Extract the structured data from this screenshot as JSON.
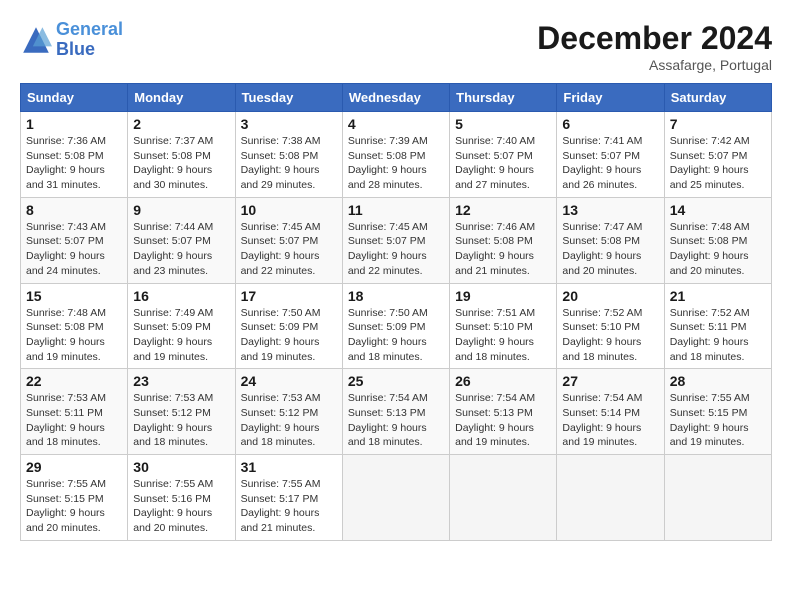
{
  "header": {
    "logo_line1": "General",
    "logo_line2": "Blue",
    "month_title": "December 2024",
    "location": "Assafarge, Portugal"
  },
  "weekdays": [
    "Sunday",
    "Monday",
    "Tuesday",
    "Wednesday",
    "Thursday",
    "Friday",
    "Saturday"
  ],
  "weeks": [
    [
      {
        "day": "1",
        "sunrise": "Sunrise: 7:36 AM",
        "sunset": "Sunset: 5:08 PM",
        "daylight": "Daylight: 9 hours and 31 minutes."
      },
      {
        "day": "2",
        "sunrise": "Sunrise: 7:37 AM",
        "sunset": "Sunset: 5:08 PM",
        "daylight": "Daylight: 9 hours and 30 minutes."
      },
      {
        "day": "3",
        "sunrise": "Sunrise: 7:38 AM",
        "sunset": "Sunset: 5:08 PM",
        "daylight": "Daylight: 9 hours and 29 minutes."
      },
      {
        "day": "4",
        "sunrise": "Sunrise: 7:39 AM",
        "sunset": "Sunset: 5:08 PM",
        "daylight": "Daylight: 9 hours and 28 minutes."
      },
      {
        "day": "5",
        "sunrise": "Sunrise: 7:40 AM",
        "sunset": "Sunset: 5:07 PM",
        "daylight": "Daylight: 9 hours and 27 minutes."
      },
      {
        "day": "6",
        "sunrise": "Sunrise: 7:41 AM",
        "sunset": "Sunset: 5:07 PM",
        "daylight": "Daylight: 9 hours and 26 minutes."
      },
      {
        "day": "7",
        "sunrise": "Sunrise: 7:42 AM",
        "sunset": "Sunset: 5:07 PM",
        "daylight": "Daylight: 9 hours and 25 minutes."
      }
    ],
    [
      {
        "day": "8",
        "sunrise": "Sunrise: 7:43 AM",
        "sunset": "Sunset: 5:07 PM",
        "daylight": "Daylight: 9 hours and 24 minutes."
      },
      {
        "day": "9",
        "sunrise": "Sunrise: 7:44 AM",
        "sunset": "Sunset: 5:07 PM",
        "daylight": "Daylight: 9 hours and 23 minutes."
      },
      {
        "day": "10",
        "sunrise": "Sunrise: 7:45 AM",
        "sunset": "Sunset: 5:07 PM",
        "daylight": "Daylight: 9 hours and 22 minutes."
      },
      {
        "day": "11",
        "sunrise": "Sunrise: 7:45 AM",
        "sunset": "Sunset: 5:07 PM",
        "daylight": "Daylight: 9 hours and 22 minutes."
      },
      {
        "day": "12",
        "sunrise": "Sunrise: 7:46 AM",
        "sunset": "Sunset: 5:08 PM",
        "daylight": "Daylight: 9 hours and 21 minutes."
      },
      {
        "day": "13",
        "sunrise": "Sunrise: 7:47 AM",
        "sunset": "Sunset: 5:08 PM",
        "daylight": "Daylight: 9 hours and 20 minutes."
      },
      {
        "day": "14",
        "sunrise": "Sunrise: 7:48 AM",
        "sunset": "Sunset: 5:08 PM",
        "daylight": "Daylight: 9 hours and 20 minutes."
      }
    ],
    [
      {
        "day": "15",
        "sunrise": "Sunrise: 7:48 AM",
        "sunset": "Sunset: 5:08 PM",
        "daylight": "Daylight: 9 hours and 19 minutes."
      },
      {
        "day": "16",
        "sunrise": "Sunrise: 7:49 AM",
        "sunset": "Sunset: 5:09 PM",
        "daylight": "Daylight: 9 hours and 19 minutes."
      },
      {
        "day": "17",
        "sunrise": "Sunrise: 7:50 AM",
        "sunset": "Sunset: 5:09 PM",
        "daylight": "Daylight: 9 hours and 19 minutes."
      },
      {
        "day": "18",
        "sunrise": "Sunrise: 7:50 AM",
        "sunset": "Sunset: 5:09 PM",
        "daylight": "Daylight: 9 hours and 18 minutes."
      },
      {
        "day": "19",
        "sunrise": "Sunrise: 7:51 AM",
        "sunset": "Sunset: 5:10 PM",
        "daylight": "Daylight: 9 hours and 18 minutes."
      },
      {
        "day": "20",
        "sunrise": "Sunrise: 7:52 AM",
        "sunset": "Sunset: 5:10 PM",
        "daylight": "Daylight: 9 hours and 18 minutes."
      },
      {
        "day": "21",
        "sunrise": "Sunrise: 7:52 AM",
        "sunset": "Sunset: 5:11 PM",
        "daylight": "Daylight: 9 hours and 18 minutes."
      }
    ],
    [
      {
        "day": "22",
        "sunrise": "Sunrise: 7:53 AM",
        "sunset": "Sunset: 5:11 PM",
        "daylight": "Daylight: 9 hours and 18 minutes."
      },
      {
        "day": "23",
        "sunrise": "Sunrise: 7:53 AM",
        "sunset": "Sunset: 5:12 PM",
        "daylight": "Daylight: 9 hours and 18 minutes."
      },
      {
        "day": "24",
        "sunrise": "Sunrise: 7:53 AM",
        "sunset": "Sunset: 5:12 PM",
        "daylight": "Daylight: 9 hours and 18 minutes."
      },
      {
        "day": "25",
        "sunrise": "Sunrise: 7:54 AM",
        "sunset": "Sunset: 5:13 PM",
        "daylight": "Daylight: 9 hours and 18 minutes."
      },
      {
        "day": "26",
        "sunrise": "Sunrise: 7:54 AM",
        "sunset": "Sunset: 5:13 PM",
        "daylight": "Daylight: 9 hours and 19 minutes."
      },
      {
        "day": "27",
        "sunrise": "Sunrise: 7:54 AM",
        "sunset": "Sunset: 5:14 PM",
        "daylight": "Daylight: 9 hours and 19 minutes."
      },
      {
        "day": "28",
        "sunrise": "Sunrise: 7:55 AM",
        "sunset": "Sunset: 5:15 PM",
        "daylight": "Daylight: 9 hours and 19 minutes."
      }
    ],
    [
      {
        "day": "29",
        "sunrise": "Sunrise: 7:55 AM",
        "sunset": "Sunset: 5:15 PM",
        "daylight": "Daylight: 9 hours and 20 minutes."
      },
      {
        "day": "30",
        "sunrise": "Sunrise: 7:55 AM",
        "sunset": "Sunset: 5:16 PM",
        "daylight": "Daylight: 9 hours and 20 minutes."
      },
      {
        "day": "31",
        "sunrise": "Sunrise: 7:55 AM",
        "sunset": "Sunset: 5:17 PM",
        "daylight": "Daylight: 9 hours and 21 minutes."
      },
      null,
      null,
      null,
      null
    ]
  ]
}
